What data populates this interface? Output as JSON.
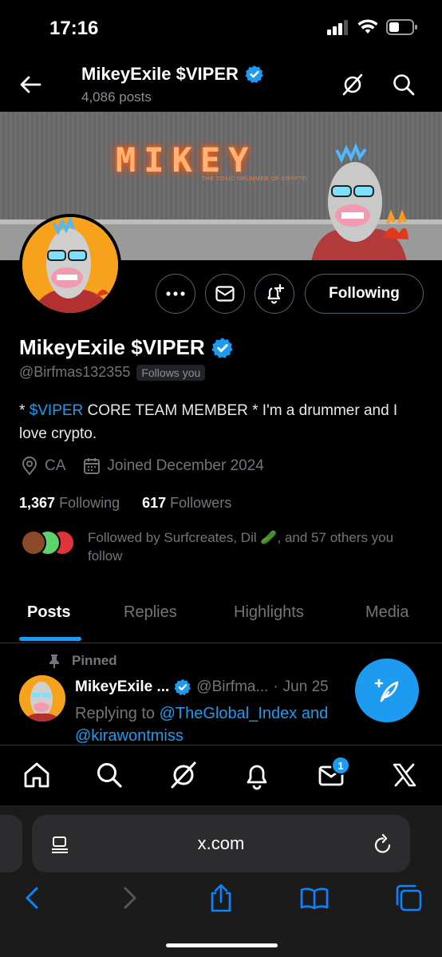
{
  "status_bar": {
    "time": "17:16"
  },
  "header": {
    "name": "MikeyExile $VIPER",
    "posts_count": "4,086 posts"
  },
  "banner": {
    "logo_text": "MIKEY",
    "tagline": "THE TOXIC DRUMMER OF CRYPTO"
  },
  "profile": {
    "name": "MikeyExile $VIPER",
    "handle": "@Birfmas132355",
    "follows_you": "Follows you",
    "bio_prefix": "* ",
    "bio_link": "$VIPER",
    "bio_rest": " CORE TEAM MEMBER * I'm a drummer and I love crypto.",
    "location": "CA",
    "joined": "Joined December 2024",
    "following_count": "1,367",
    "following_label": "Following",
    "followers_count": "617",
    "followers_label": "Followers",
    "followed_by": "Followed by Surfcreates, Dil 🥒, and 57 others you follow"
  },
  "actions": {
    "following_label": "Following"
  },
  "tabs": [
    {
      "label": "Posts"
    },
    {
      "label": "Replies"
    },
    {
      "label": "Highlights"
    },
    {
      "label": "Media"
    }
  ],
  "pinned_post": {
    "pinned_label": "Pinned",
    "author": "MikeyExile ...",
    "handle": "@Birfma...",
    "dot": "·",
    "date": "Jun 25",
    "replying_prefix": "Replying to ",
    "reply_to_1": "@TheGlobal_Index",
    "reply_and": " and ",
    "reply_to_2": "@kirawontmiss"
  },
  "bottom_nav": {
    "messages_badge": "1"
  },
  "safari": {
    "url": "x.com"
  },
  "colors": {
    "accent": "#1d9bf0",
    "background": "#000000",
    "muted_text": "#71767b"
  }
}
